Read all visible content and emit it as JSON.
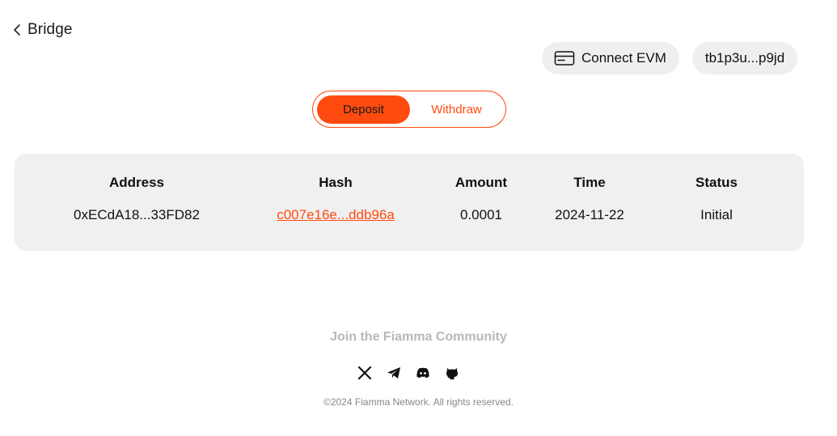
{
  "header": {
    "back_label": "Bridge",
    "connect_evm_label": "Connect EVM",
    "wallet_address": "tb1p3u...p9jd"
  },
  "tabs": {
    "deposit": "Deposit",
    "withdraw": "Withdraw",
    "active": "deposit"
  },
  "table": {
    "columns": [
      "Address",
      "Hash",
      "Amount",
      "Time",
      "Status"
    ],
    "rows": [
      {
        "address": "0xECdA18...33FD82",
        "hash": "c007e16e...ddb96a",
        "amount": "0.0001",
        "time": "2024-11-22",
        "status": "Initial"
      }
    ]
  },
  "footer": {
    "community_title": "Join the Fiamma Community",
    "socials": [
      "x-icon",
      "telegram-icon",
      "discord-icon",
      "github-icon"
    ],
    "copyright": "©2024 Fiamma Network. All rights reserved."
  },
  "colors": {
    "accent": "#ff4b0f",
    "panel": "#f0f0f0",
    "pill": "#efefef"
  }
}
